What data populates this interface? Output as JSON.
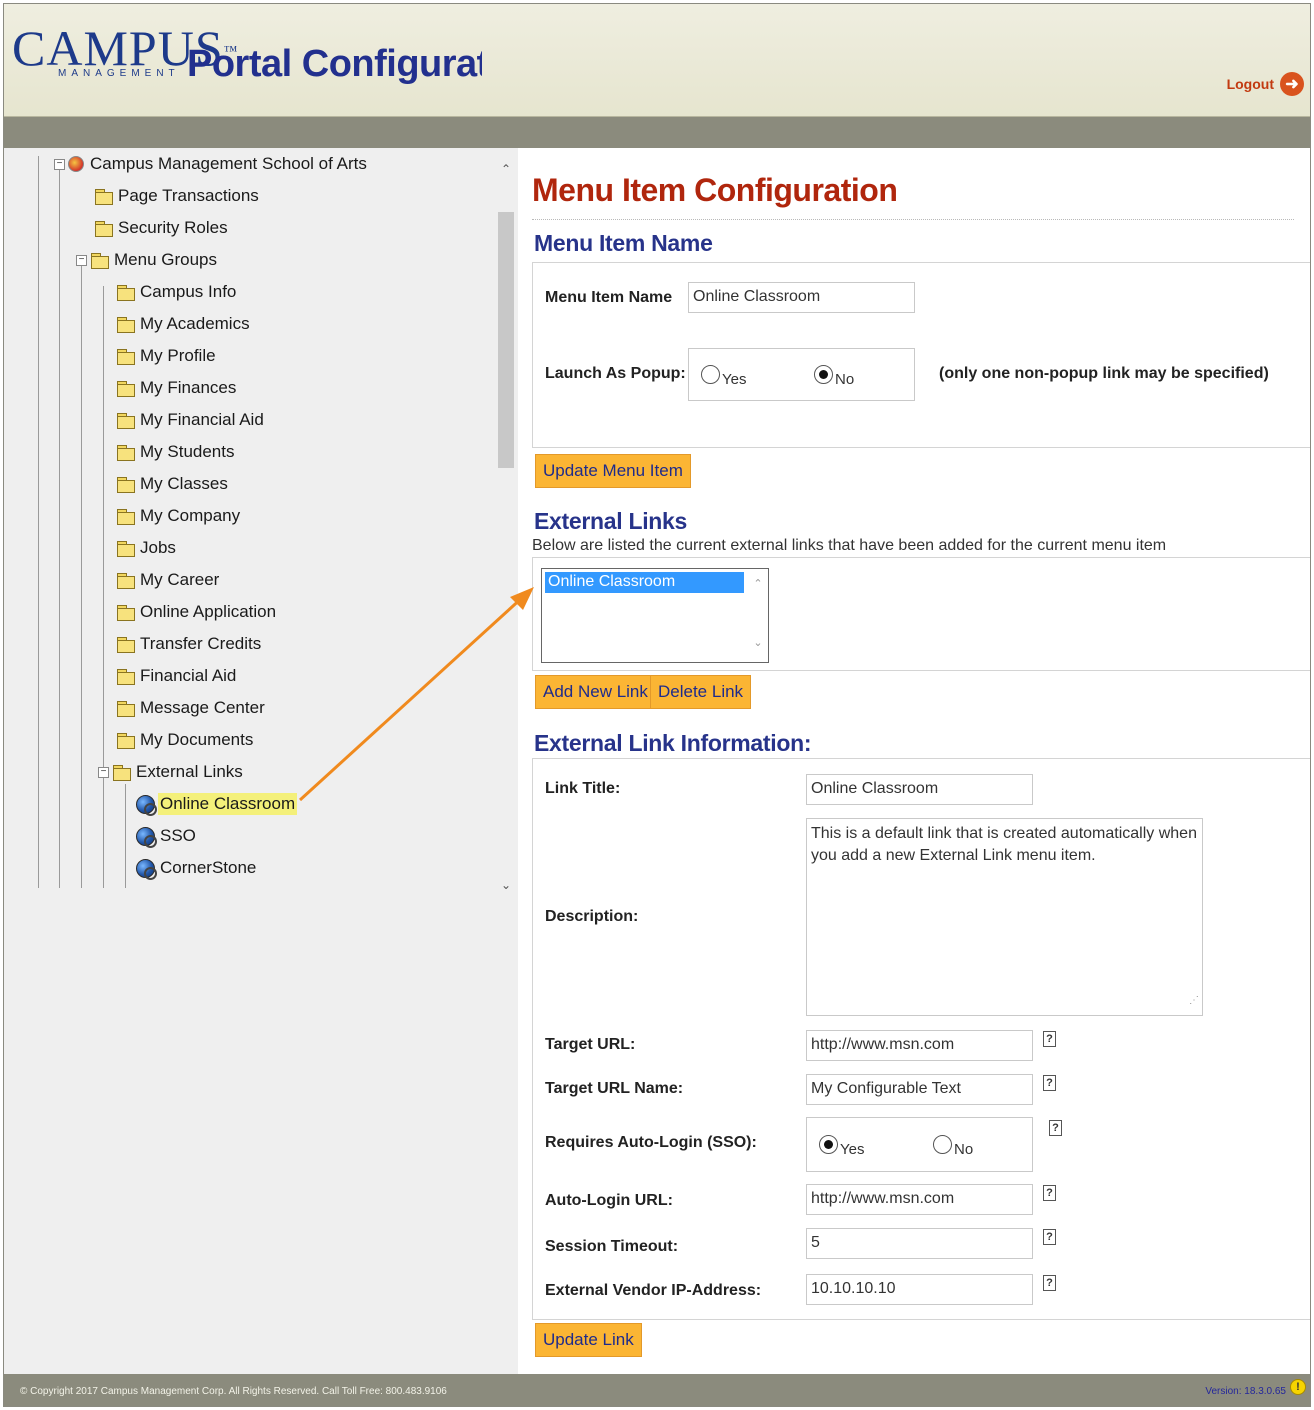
{
  "header": {
    "logo_word": "CAMPUS",
    "logo_tm": "™",
    "logo_sub": "MANAGEMENT",
    "app_title": "Portal Configuratio",
    "logout_label": "Logout"
  },
  "tree": {
    "root": "Campus Management School of Arts",
    "items": [
      {
        "label": "Page Transactions"
      },
      {
        "label": "Security Roles"
      },
      {
        "label": "Menu Groups"
      },
      {
        "label": "Campus Info"
      },
      {
        "label": "My Academics"
      },
      {
        "label": "My Profile"
      },
      {
        "label": "My Finances"
      },
      {
        "label": "My Financial Aid"
      },
      {
        "label": "My Students"
      },
      {
        "label": "My Classes"
      },
      {
        "label": "My Company"
      },
      {
        "label": "Jobs"
      },
      {
        "label": "My Career"
      },
      {
        "label": "Online Application"
      },
      {
        "label": "Transfer Credits"
      },
      {
        "label": "Financial Aid"
      },
      {
        "label": "Message Center"
      },
      {
        "label": "My Documents"
      },
      {
        "label": "External Links"
      },
      {
        "label": "Online Classroom"
      },
      {
        "label": "SSO"
      },
      {
        "label": "CornerStone"
      }
    ],
    "selected": "Online Classroom"
  },
  "main": {
    "title": "Menu Item Configuration",
    "menu_item_section": "Menu Item Name",
    "menu_item_name_label": "Menu Item Name",
    "menu_item_name_value": "Online Classroom",
    "launch_popup_label": "Launch As Popup:",
    "popup_yes": "Yes",
    "popup_no": "No",
    "popup_selected": "No",
    "popup_note": "(only one non-popup link may be specified)",
    "update_menu_item_button": "Update Menu Item",
    "external_links_section": "External Links",
    "external_links_note": "Below are listed the current external links that have been added for the current menu item",
    "external_links_list": [
      "Online Classroom"
    ],
    "add_link_button": "Add New Link",
    "delete_link_button": "Delete Link",
    "link_info_section": "External Link Information:",
    "link_title_label": "Link Title:",
    "link_title_value": "Online Classroom",
    "description_label": "Description:",
    "description_value": "This is a default link that is created automatically when you add a new External Link menu item.",
    "target_url_label": "Target URL:",
    "target_url_value": "http://www.msn.com",
    "target_url_name_label": "Target URL Name:",
    "target_url_name_value": "My Configurable Text",
    "auto_login_label": "Requires Auto-Login (SSO):",
    "auto_login_yes": "Yes",
    "auto_login_no": "No",
    "auto_login_selected": "Yes",
    "auto_login_url_label": "Auto-Login URL:",
    "auto_login_url_value": "http://www.msn.com",
    "session_timeout_label": "Session Timeout:",
    "session_timeout_value": "5",
    "vendor_ip_label": "External Vendor IP-Address:",
    "vendor_ip_value": "10.10.10.10",
    "help_glyph": "?",
    "update_link_button": "Update Link"
  },
  "footer": {
    "copyright": "© Copyright 2017 Campus Management Corp. All Rights Reserved. Call Toll Free: 800.483.9106",
    "version": "Version: 18.3.0.65"
  },
  "colors": {
    "title_red": "#b0260d",
    "heading_blue": "#27338a",
    "button_orange": "#fbb534",
    "selected_yellow": "#f4f07a",
    "arrow_orange": "#f08a1e",
    "band_gray": "#8b8b7d"
  },
  "icons": {
    "tree_folder": "folder-icon",
    "tree_link": "globe-link-icon",
    "logout": "logout-arrow-icon",
    "help": "help-icon",
    "version_warning": "warning-icon"
  }
}
